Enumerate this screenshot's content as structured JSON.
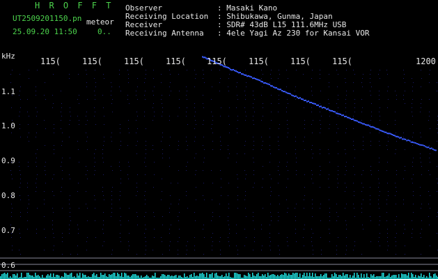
{
  "header": {
    "app_title": "H R O F F T",
    "filename": "UT2509201150.pn",
    "detection_label": "meteor",
    "datetime": "25.09.20 11:50",
    "counter": "0..",
    "info_labels": [
      "Observer",
      "Receiving Location",
      "Receiver",
      "Receiving Antenna"
    ],
    "info_values": [
      ": Masaki Kano",
      ": Shibukawa, Gunma, Japan",
      ": SDR# 43dB L15 111.6MHz USB",
      ": 4ele Yagi Az 230 for Kansai VOR"
    ]
  },
  "spectrogram": {
    "y_unit": "kHz",
    "y_ticks": [
      "1.1",
      "1.0",
      "0.9",
      "0.8",
      "0.7",
      "0.6"
    ],
    "x_ticks": [
      "115(",
      "115(",
      "115(",
      "115(",
      "115(",
      "115(",
      "115(",
      "115(",
      "1200"
    ],
    "colors": {
      "background": "#000000",
      "dots": "#1c1c6e",
      "trace": "#3a5cff",
      "noise": "#1ee0e0",
      "lines": "#8a8a9a",
      "header_green": "#4cd34c",
      "header_white": "#e8e8e8"
    }
  }
}
